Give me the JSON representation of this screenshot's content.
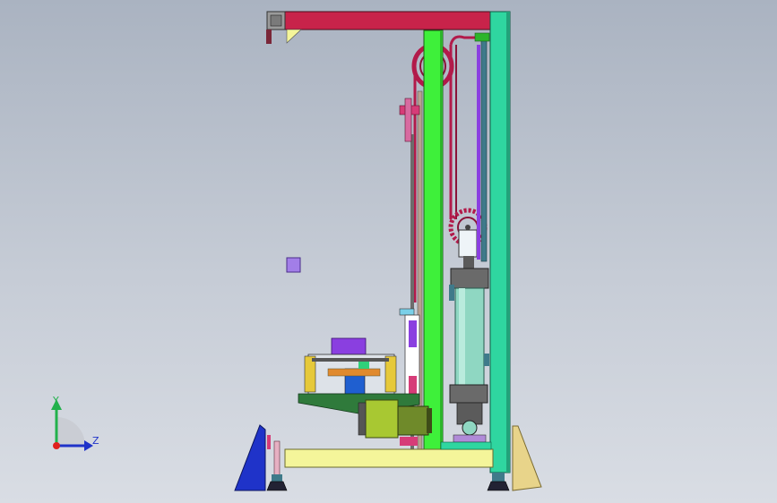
{
  "viewport": {
    "background_top": "#aab3c1",
    "background_bottom": "#d9dde4"
  },
  "triad": {
    "y_label": "Y",
    "z_label": "Z",
    "y_color": "#22b14c",
    "z_color": "#1f33c9",
    "x_color": "#e0201c"
  },
  "colors": {
    "top_beam": "#c8234a",
    "upright_green": "#3ef03a",
    "upright_teal": "#2fd6a0",
    "base_beam": "#f4f59a",
    "cylinder": "#8fd7c2",
    "motor": "#a8c832",
    "carriage_plate": "#2f7a3b",
    "block_purple": "#8a3fe0",
    "foot_blue": "#1f33c9",
    "foot_tan": "#e8d48a",
    "chain": "#b21a4a"
  }
}
